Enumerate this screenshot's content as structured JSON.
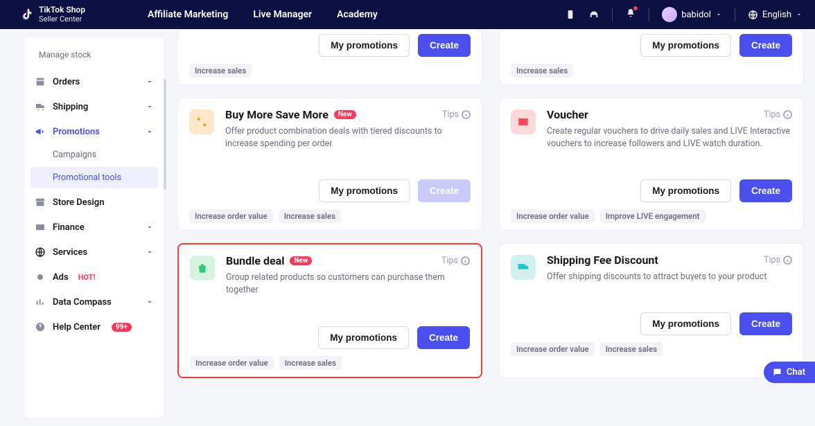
{
  "header": {
    "brand_line1": "TikTok Shop",
    "brand_line2": "Seller Center",
    "nav": [
      "Affiliate Marketing",
      "Live Manager",
      "Academy"
    ],
    "user": "babidol",
    "language": "English"
  },
  "sidebar": {
    "top_label": "Manage stock",
    "items": [
      {
        "label": "Orders",
        "expandable": true
      },
      {
        "label": "Shipping",
        "expandable": true
      },
      {
        "label": "Promotions",
        "expandable": true,
        "active": true,
        "subs": [
          {
            "label": "Campaigns"
          },
          {
            "label": "Promotional tools",
            "selected": true
          }
        ]
      },
      {
        "label": "Store Design"
      },
      {
        "label": "Finance",
        "expandable": true
      },
      {
        "label": "Services",
        "expandable": true
      },
      {
        "label": "Ads",
        "hot": "HOT!"
      },
      {
        "label": "Data Compass",
        "expandable": true
      },
      {
        "label": "Help Center",
        "count": "99+"
      }
    ]
  },
  "common": {
    "my_promotions": "My promotions",
    "create": "Create",
    "tips": "Tips",
    "new": "New"
  },
  "cards": {
    "stub_left": {
      "tags": [
        "Increase sales"
      ]
    },
    "stub_right": {
      "tags": [
        "Increase sales"
      ]
    },
    "buy_more": {
      "title": "Buy More Save More",
      "desc": "Offer product combination deals with tiered discounts to increase spending per order",
      "tags": [
        "Increase order value",
        "Increase sales"
      ],
      "new": true,
      "create_muted": true
    },
    "voucher": {
      "title": "Voucher",
      "desc": "Create regular vouchers to drive daily sales and LIVE Interactive vouchers to increase followers and LIVE watch duration.",
      "tags": [
        "Increase order value",
        "Improve LIVE engagement"
      ]
    },
    "bundle": {
      "title": "Bundle deal",
      "desc": "Group related products so customers can purchase them together",
      "tags": [
        "Increase order value",
        "Increase sales"
      ],
      "new": true,
      "highlight": true
    },
    "shipping_fee": {
      "title": "Shipping Fee Discount",
      "desc": "Offer shipping discounts to attract buyers to your product",
      "tags": [
        "Increase order value",
        "Increase sales"
      ]
    }
  },
  "chat": {
    "label": "Chat"
  }
}
